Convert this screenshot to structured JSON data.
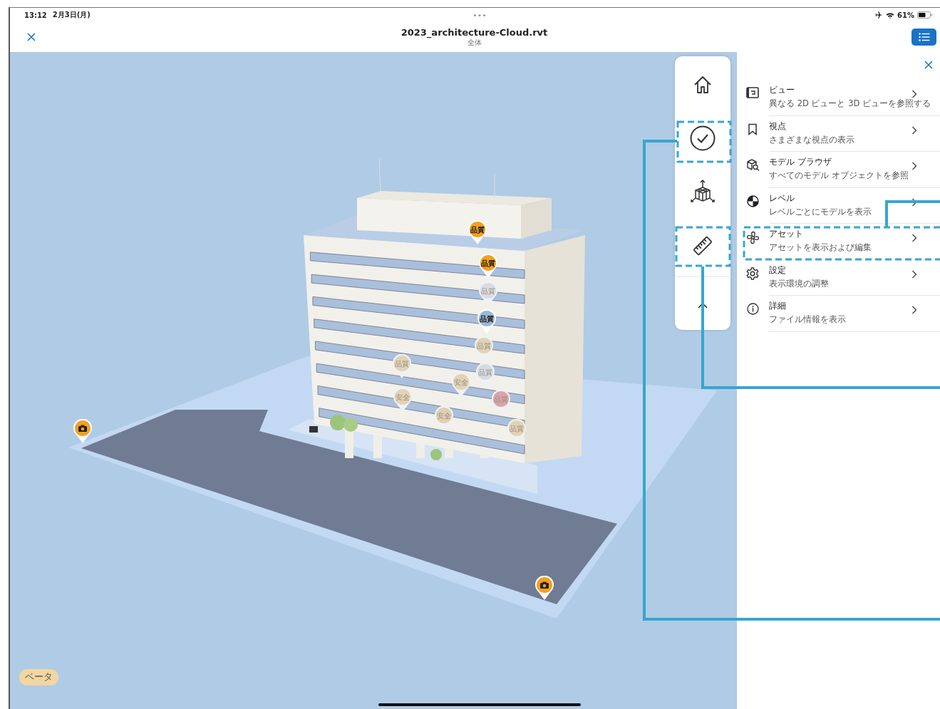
{
  "status_bar": {
    "time": "13:12",
    "date": "2月3日(月)",
    "battery": "61%"
  },
  "nav": {
    "title": "2023_architecture-Cloud.rvt",
    "subtitle": "全体"
  },
  "pins": [
    {
      "kind": "issue",
      "label": "品質",
      "color": "#f5a01e",
      "faded": false
    },
    {
      "kind": "issue",
      "label": "品質",
      "color": "#f5a01e",
      "faded": false
    },
    {
      "kind": "issue",
      "label": "品質",
      "color": "#d9dde3",
      "faded": true
    },
    {
      "kind": "issue",
      "label": "品質",
      "color": "#9bb7da",
      "faded": false
    },
    {
      "kind": "issue",
      "label": "品質",
      "color": "#e2d3b6",
      "faded": true
    },
    {
      "kind": "issue",
      "label": "品質",
      "color": "#e3d2b4",
      "faded": true
    },
    {
      "kind": "issue",
      "label": "品質",
      "color": "#d5dbe3",
      "faded": true
    },
    {
      "kind": "issue",
      "label": "安全",
      "color": "#e3d2b4",
      "faded": true
    },
    {
      "kind": "issue",
      "label": "安全",
      "color": "#e3d2b4",
      "faded": true
    },
    {
      "kind": "issue",
      "label": "品質",
      "color": "#dda3a8",
      "faded": true
    },
    {
      "kind": "issue",
      "label": "安全",
      "color": "#e0cfb2",
      "faded": true
    },
    {
      "kind": "issue",
      "label": "品質",
      "color": "#e3d2b4",
      "faded": true
    },
    {
      "kind": "camera",
      "color": "#f5a01e",
      "faded": false
    },
    {
      "kind": "camera",
      "color": "#f5a01e",
      "faded": false
    }
  ],
  "beta_badge": "ベータ",
  "panel_items": [
    {
      "kind": "view",
      "title": "ビュー",
      "subtitle": "異なる 2D ビューと 3D ビューを参照する"
    },
    {
      "kind": "bookmark",
      "title": "視点",
      "subtitle": "さまざまな視点の表示"
    },
    {
      "kind": "browser",
      "title": "モデル ブラウザ",
      "subtitle": "すべてのモデル オブジェクトを参照"
    },
    {
      "kind": "level",
      "title": "レベル",
      "subtitle": "レベルごとにモデルを表示"
    },
    {
      "kind": "asset",
      "title": "アセット",
      "subtitle": "アセットを表示および編集"
    },
    {
      "kind": "settings",
      "title": "設定",
      "subtitle": "表示環境の調整"
    },
    {
      "kind": "info",
      "title": "詳細",
      "subtitle": "ファイル情報を表示"
    }
  ]
}
